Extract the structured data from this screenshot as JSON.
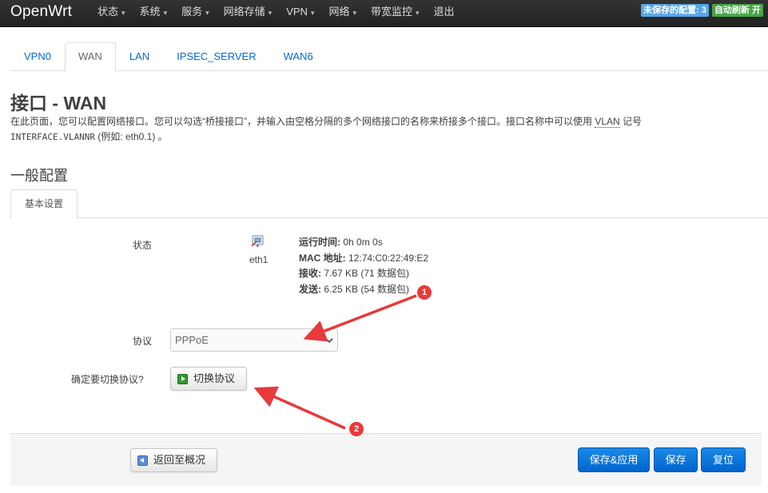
{
  "navbar": {
    "brand": "OpenWrt",
    "menu": [
      {
        "label": "状态"
      },
      {
        "label": "系统"
      },
      {
        "label": "服务"
      },
      {
        "label": "网络存储"
      },
      {
        "label": "VPN"
      },
      {
        "label": "网络"
      },
      {
        "label": "带宽监控"
      },
      {
        "label": "退出"
      }
    ],
    "caret": "▾",
    "unsaved_badge": "未保存的配置: 3",
    "refresh_badge": "自动刷新 开"
  },
  "interface_tabs": [
    "VPN0",
    "WAN",
    "LAN",
    "IPSEC_SERVER",
    "WAN6"
  ],
  "active_tab": "WAN",
  "page": {
    "title": "接口 - WAN",
    "description_part1": "在此页面，您可以配置网络接口。您可以勾选“桥接接口”，并输入由空格分隔的多个网络接口的名称来桥接多个接口。接口名称中可以使用 ",
    "description_abbr": "VLAN",
    "description_part2": " 记号 ",
    "description_code": "INTERFACE.VLANNR",
    "description_part3": " (例如: ",
    "description_example": "eth0.1",
    "description_part4": ") 。"
  },
  "section": {
    "title": "一般配置",
    "subtab": "基本设置"
  },
  "status": {
    "label": "状态",
    "device": "eth1",
    "uptime_label": "运行时间:",
    "uptime_value": " 0h 0m 0s",
    "mac_label": "MAC 地址:",
    "mac_value": " 12:74:C0:22:49:E2",
    "rx_label": "接收:",
    "rx_value": " 7.67 KB (71 数据包)",
    "tx_label": "发送:",
    "tx_value": " 6.25 KB (54 数据包)"
  },
  "protocol": {
    "label": "协议",
    "selected": "PPPoE"
  },
  "switch_protocol": {
    "label": "确定要切换协议?",
    "button": "切换协议"
  },
  "footer": {
    "back_button": "返回至概况",
    "save_apply_button": "保存&应用",
    "save_button": "保存",
    "reset_button": "复位"
  },
  "annotations": {
    "marker1": "1",
    "marker2": "2",
    "color": "#e83a3a"
  }
}
